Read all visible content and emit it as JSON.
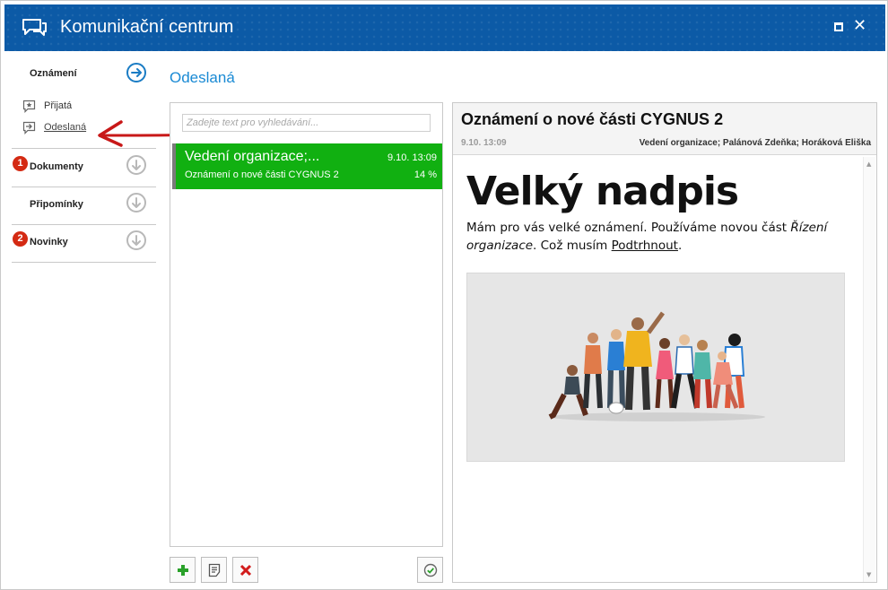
{
  "titlebar": {
    "title": "Komunikační centrum"
  },
  "nav": {
    "announcements": {
      "label": "Oznámení"
    },
    "received": {
      "label": "Přijatá"
    },
    "sent": {
      "label": "Odeslaná"
    },
    "documents": {
      "label": "Dokumenty",
      "badge": "1"
    },
    "reminders": {
      "label": "Připomínky"
    },
    "news": {
      "label": "Novinky",
      "badge": "2"
    }
  },
  "section": {
    "title": "Odeslaná"
  },
  "search": {
    "placeholder": "Zadejte text pro vyhledávání..."
  },
  "messages": [
    {
      "title": "Vedení organizace;...",
      "date": "9.10. 13:09",
      "subject": "Oznámení o nové části CYGNUS 2",
      "progress": "14 %"
    }
  ],
  "detail": {
    "title": "Oznámení o nové části CYGNUS 2",
    "date": "9.10. 13:09",
    "recipients": "Vedení organizace; Palánová Zdeňka; Horáková Eliška",
    "heading": "Velký nadpis",
    "para_1": "Mám pro vás velké oznámení. Používáme novou část ",
    "para_italic": "Řízení organizace",
    "para_2": ". Což musím ",
    "para_underline": "Podtrhnout",
    "para_3": "."
  },
  "colors": {
    "titlebar": "#0c5aa6",
    "accent": "#1a8ad4",
    "selected": "#11b011",
    "badge": "#d42a13",
    "annotation": "#c81818"
  },
  "icons": {
    "add": "plus-icon",
    "note": "note-icon",
    "delete": "delete-icon",
    "confirm": "check-circle-icon"
  }
}
